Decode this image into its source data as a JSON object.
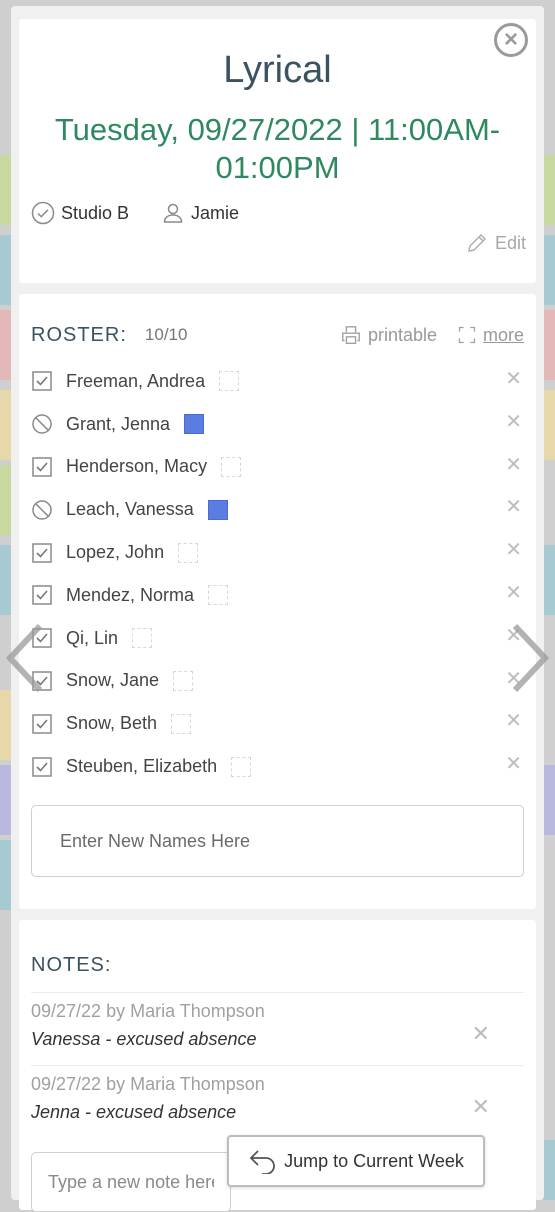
{
  "event": {
    "title": "Lyrical",
    "datetime": "Tuesday, 09/27/2022 | 11:00AM-01:00PM",
    "location": "Studio B",
    "instructor": "Jamie",
    "edit_label": "Edit"
  },
  "roster": {
    "label": "ROSTER:",
    "count": "10/10",
    "printable_label": "printable",
    "more_label": "more",
    "students": [
      {
        "name": "Freeman, Andrea",
        "status": "present",
        "tag": false
      },
      {
        "name": "Grant, Jenna",
        "status": "absent",
        "tag": true
      },
      {
        "name": "Henderson, Macy",
        "status": "present",
        "tag": false
      },
      {
        "name": "Leach, Vanessa",
        "status": "absent",
        "tag": true
      },
      {
        "name": "Lopez, John",
        "status": "present",
        "tag": false
      },
      {
        "name": "Mendez, Norma",
        "status": "present",
        "tag": false
      },
      {
        "name": "Qi, Lin",
        "status": "present",
        "tag": false
      },
      {
        "name": "Snow, Jane",
        "status": "present",
        "tag": false
      },
      {
        "name": "Snow, Beth",
        "status": "present",
        "tag": false
      },
      {
        "name": "Steuben, Elizabeth",
        "status": "present",
        "tag": false
      }
    ],
    "new_names_placeholder": "Enter New Names Here"
  },
  "notes": {
    "label": "NOTES:",
    "items": [
      {
        "meta": "09/27/22 by Maria Thompson",
        "text": "Vanessa - excused absence"
      },
      {
        "meta": "09/27/22 by Maria Thompson",
        "text": "Jenna - excused absence"
      }
    ],
    "new_note_placeholder": "Type a new note here"
  },
  "jump_button_label": "Jump to Current Week",
  "colors": {
    "title": "#3b5360",
    "datetime": "#2e8a5e",
    "tag_fill": "#5b7ce0"
  },
  "icons": {
    "close": "close-circle-icon",
    "location": "check-circle-icon",
    "instructor": "user-icon",
    "edit": "pencil-icon",
    "printable": "printer-icon",
    "more": "expand-icon",
    "present": "checkbox-checked-icon",
    "absent": "no-entry-icon",
    "remove": "close-icon",
    "jump": "undo-arrow-icon",
    "prev": "chevron-left-icon",
    "next": "chevron-right-icon"
  }
}
